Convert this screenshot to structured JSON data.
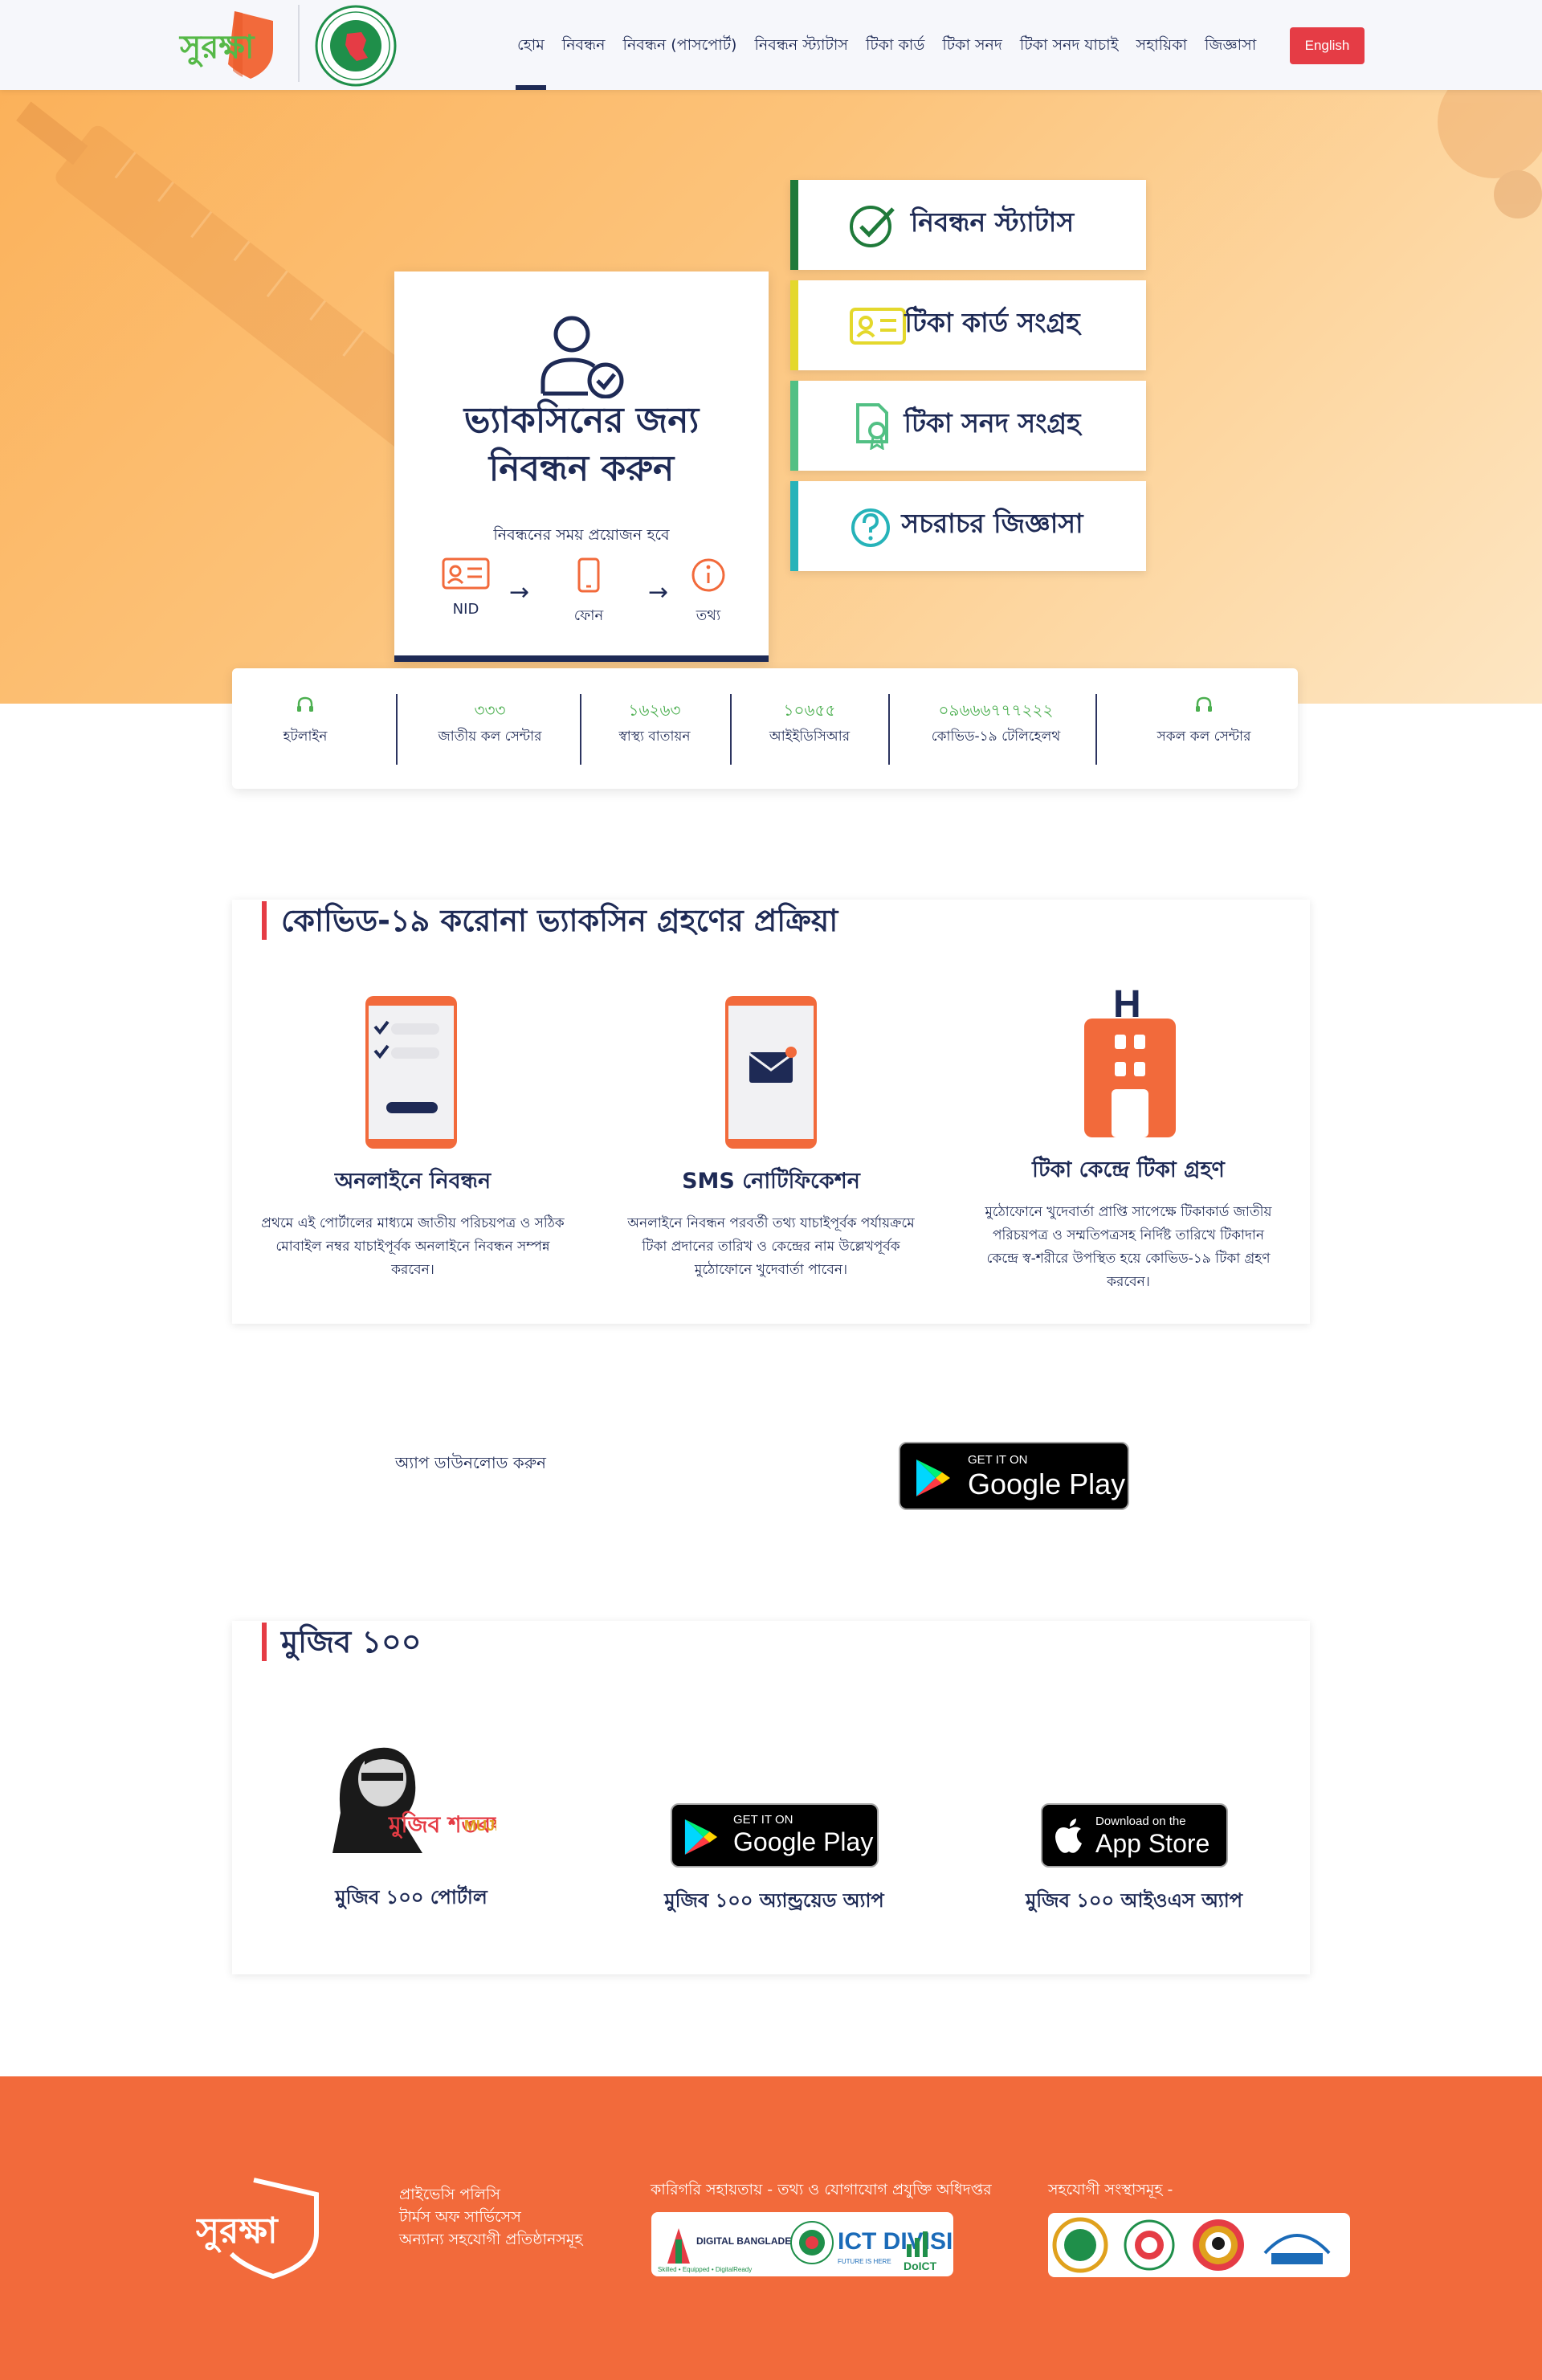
{
  "header": {
    "logo_text": "সুরক্ষা",
    "nav": [
      {
        "label": "হোম",
        "active": true
      },
      {
        "label": "নিবন্ধন",
        "active": false
      },
      {
        "label": "নিবন্ধন (পাসপোর্ট)",
        "active": false
      },
      {
        "label": "নিবন্ধন স্ট্যাটাস",
        "active": false
      },
      {
        "label": "টিকা কার্ড",
        "active": false
      },
      {
        "label": "টিকা সনদ",
        "active": false
      },
      {
        "label": "টিকা সনদ যাচাই",
        "active": false
      },
      {
        "label": "সহায়িকা",
        "active": false
      },
      {
        "label": "জিজ্ঞাসা",
        "active": false
      }
    ],
    "lang_button": "English"
  },
  "hero": {
    "register_card": {
      "title_line1": "ভ্যাকসিনের জন্য",
      "title_line2": "নিবন্ধন করুন",
      "subtitle": "নিবন্ধনের সময় প্রয়োজন হবে",
      "requirements": [
        "NID",
        "ফোন",
        "তথ্য"
      ]
    },
    "side_cards": [
      {
        "label": "নিবন্ধন স্ট্যাটাস",
        "icon": "check-circle-icon",
        "color": "#1f7a3a"
      },
      {
        "label": "টিকা কার্ড সংগ্রহ",
        "icon": "id-card-icon",
        "color": "#e4d82c"
      },
      {
        "label": "টিকা সনদ সংগ্রহ",
        "icon": "certificate-icon",
        "color": "#52c084"
      },
      {
        "label": "সচরাচর জিজ্ঞাসা",
        "icon": "question-circle-icon",
        "color": "#26b3b9"
      }
    ]
  },
  "hotlines": [
    {
      "number": "",
      "caption": "হটলাইন",
      "icon": "headset-icon"
    },
    {
      "number": "৩৩৩",
      "caption": "জাতীয় কল সেন্টার"
    },
    {
      "number": "১৬২৬৩",
      "caption": "স্বাস্থ্য বাতায়ন"
    },
    {
      "number": "১০৬৫৫",
      "caption": "আইইডিসিআর"
    },
    {
      "number": "০৯৬৬৬৭৭৭২২২",
      "caption": "কোভিড-১৯ টেলিহেলথ"
    },
    {
      "number": "",
      "caption": "সকল কল সেন্টার",
      "icon": "headset-icon"
    }
  ],
  "process": {
    "title": "কোভিড-১৯ করোনা ভ্যাকসিন গ্রহণের প্রক্রিয়া",
    "steps": [
      {
        "title": "অনলাইনে নিবন্ধন",
        "desc_lines": [
          "প্রথমে এই পোর্টালের মাধ্যমে জাতীয় পরিচয়পত্র ও সঠিক",
          "মোবাইল নম্বর যাচাইপূর্বক অনলাইনে নিবন্ধন সম্পন্ন",
          "করবেন।"
        ]
      },
      {
        "title": "SMS নোটিফিকেশন",
        "desc_lines": [
          "অনলাইনে নিবন্ধন পরবর্তী তথ্য যাচাইপূর্বক পর্যায়ক্রমে",
          "টিকা প্রদানের তারিখ ও কেন্দ্রের নাম উল্লেখপূর্বক",
          "মুঠোফোনে খুদেবার্তা পাবেন।"
        ]
      },
      {
        "title": "টিকা কেন্দ্রে টিকা গ্রহণ",
        "desc_lines": [
          "মুঠোফোনে খুদেবার্তা প্রাপ্তি সাপেক্ষে টিকাকার্ড জাতীয়",
          "পরিচয়পত্র ও সম্মতিপত্রসহ নির্দিষ্ট তারিখে টিকাদান",
          "কেন্দ্রে স্ব-শরীরে উপস্থিত হয়ে কোভিড-১৯ টিকা গ্রহণ",
          "করবেন।"
        ]
      }
    ]
  },
  "download": {
    "label": "অ্যাপ ডাউনলোড করুন",
    "google_play_small": "GET IT ON",
    "google_play_big": "Google Play"
  },
  "mujib": {
    "title": "মুজিব ১০০",
    "logo_text": "মুজিব শতবর্ষ",
    "logo_text_en": "MUJIB 100",
    "items": [
      {
        "caption": "মুজিব ১০০ পোর্টাল"
      },
      {
        "caption": "মুজিব ১০০ অ্যান্ড্রয়েড অ্যাপ",
        "badge_small": "GET IT ON",
        "badge_big": "Google Play"
      },
      {
        "caption": "মুজিব ১০০ আইওএস অ্যাপ",
        "badge_small": "Download on the",
        "badge_big": "App Store"
      }
    ]
  },
  "footer": {
    "logo_text": "সুরক্ষা",
    "links": [
      "প্রাইভেসি পলিসি",
      "টার্মস অফ সার্ভিসেস",
      "অন্যান্য সহযোগী প্রতিষ্ঠানসমূহ"
    ],
    "tech_support": "কারিগরি সহায়তায় - তথ্য ও যোগাযোগ প্রযুক্তি অধিদপ্তর",
    "partners": "সহযোগী সংস্থাসমূহ -",
    "tech_logos": [
      "DIGITAL BANGLADESH",
      "ICT DIVISION",
      "DoICT"
    ],
    "tech_logo_subs": [
      "Skilled • Equipped • DigitalReady",
      "FUTURE IS HERE"
    ]
  }
}
